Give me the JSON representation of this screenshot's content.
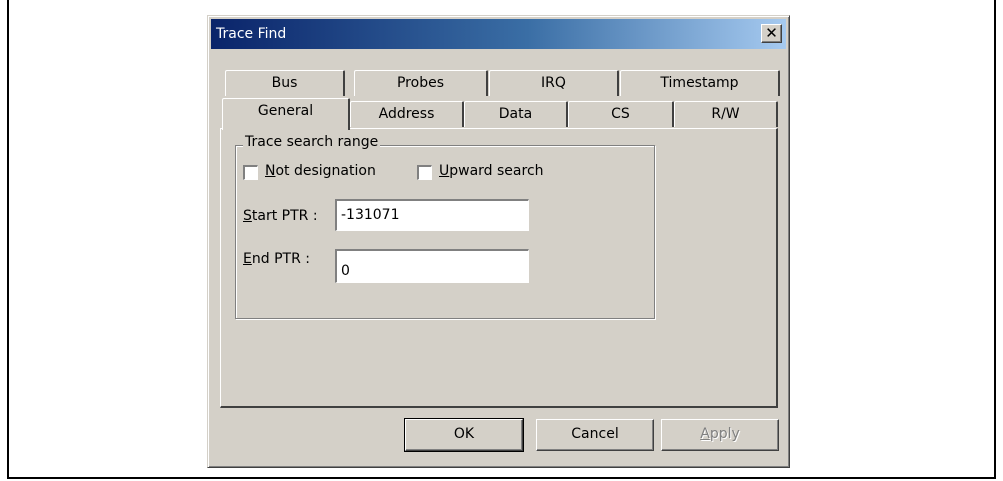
{
  "window": {
    "title": "Trace Find",
    "close_glyph": "✕"
  },
  "tabs_back": [
    "Bus",
    "Probes",
    "IRQ",
    "Timestamp"
  ],
  "tabs_front": [
    "General",
    "Address",
    "Data",
    "CS",
    "R/W"
  ],
  "active_tab": "General",
  "group": {
    "label": "Trace search range",
    "not_designation": {
      "prefix": "",
      "accel": "N",
      "rest": "ot designation",
      "checked": false
    },
    "upward_search": {
      "prefix": "",
      "accel": "U",
      "rest": "pward search",
      "checked": false
    },
    "start_ptr": {
      "accel": "S",
      "rest": "tart PTR :",
      "value": "-131071"
    },
    "end_ptr": {
      "accel": "E",
      "rest": "nd PTR :",
      "value": "0"
    }
  },
  "buttons": {
    "ok": "OK",
    "cancel": "Cancel",
    "apply_accel": "A",
    "apply_rest": "pply"
  },
  "colors": {
    "face": "#d4d0c8",
    "title_start": "#0a246a",
    "title_end": "#a6caf0"
  }
}
